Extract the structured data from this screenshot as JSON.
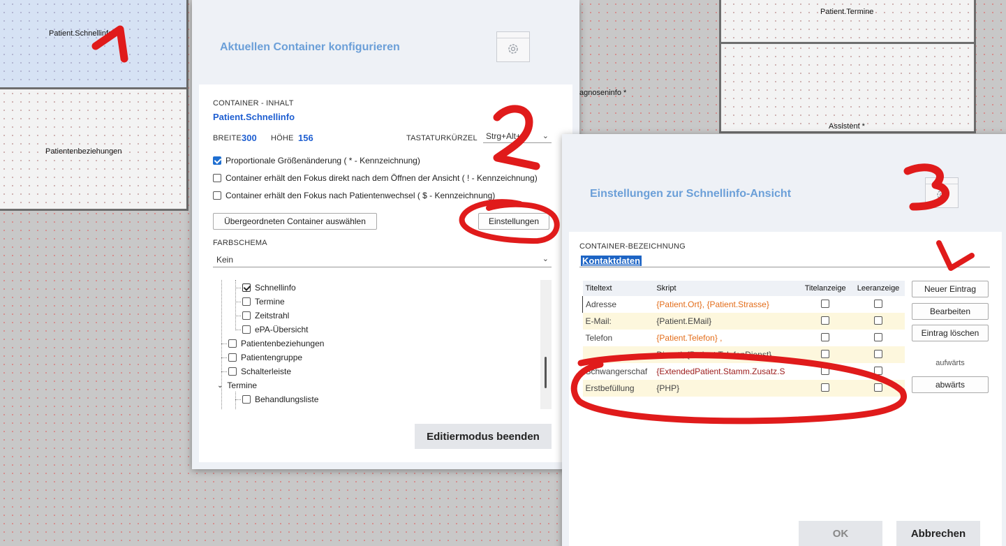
{
  "background": {
    "containers": [
      {
        "label": "Patient.Schnellinfo",
        "selected": true
      },
      {
        "label": "Patientenbeziehungen"
      },
      {
        "label": "Patient.Termine"
      },
      {
        "label": "agnoseninfo *"
      },
      {
        "label": "Assistent *"
      }
    ]
  },
  "dialog1": {
    "title": "Aktuellen Container konfigurieren",
    "section_label": "CONTAINER - INHALT",
    "container_name": "Patient.Schnellinfo",
    "width_label": "BREITE",
    "width_value": "300",
    "height_label": "HÖHE",
    "height_value": "156",
    "shortcut_label": "TASTATURKÜRZEL",
    "shortcut_value": "Strg+Alt+",
    "options": [
      {
        "label": "Proportionale Größenänderung ( * - Kennzeichnung)",
        "checked": true
      },
      {
        "label": "Container erhält den Fokus direkt nach dem Öffnen der Ansicht ( ! - Kennzeichnung)",
        "checked": false
      },
      {
        "label": "Container erhält den Fokus nach Patientenwechsel ( $ - Kennzeichnung)",
        "checked": false
      }
    ],
    "parent_button": "Übergeordneten Container auswählen",
    "settings_button": "Einstellungen",
    "color_label": "FARBSCHEMA",
    "color_value": "Kein",
    "tree": [
      {
        "label": "Schnellinfo",
        "checked": true
      },
      {
        "label": "Termine",
        "checked": false
      },
      {
        "label": "Zeitstrahl",
        "checked": false
      },
      {
        "label": "ePA-Übersicht",
        "checked": false
      },
      {
        "label": "Patientenbeziehungen",
        "checked": false
      },
      {
        "label": "Patientengruppe",
        "checked": false
      },
      {
        "label": "Schalterleiste",
        "checked": false
      },
      {
        "label": "Termine",
        "group": true
      },
      {
        "label": "Behandlungsliste",
        "checked": false
      }
    ],
    "exit_button": "Editiermodus beenden"
  },
  "dialog2": {
    "title": "Einstellungen zur Schnellinfo-Ansicht",
    "name_label": "CONTAINER-BEZEICHNUNG",
    "name_value": "Kontaktdaten",
    "columns": [
      "Titeltext",
      "Skript",
      "Titelanzeige",
      "Leeranzeige"
    ],
    "rows": [
      {
        "title": "Adresse",
        "script": "{Patient.Ort}, {Patient.Strasse}",
        "title_display": false,
        "empty_display": false
      },
      {
        "title": "E-Mail:",
        "script": "{Patient.EMail}",
        "title_display": false,
        "empty_display": false
      },
      {
        "title": "Telefon",
        "script": "{Patient.Telefon} ,",
        "title_display": false,
        "empty_display": false
      },
      {
        "title": "",
        "script": "Dienstl; {Patient.TelefonDienst}",
        "title_display": false,
        "empty_display": false
      },
      {
        "title": "Schwangerschaf",
        "script": "{ExtendedPatient.Stamm.Zusatz.S",
        "title_display": false,
        "empty_display": false
      },
      {
        "title": "Erstbefüllung",
        "script": "{PHP}",
        "title_display": false,
        "empty_display": false
      }
    ],
    "buttons": {
      "new": "Neuer Eintrag",
      "edit": "Bearbeiten",
      "delete": "Eintrag löschen",
      "up": "aufwärts",
      "down": "abwärts"
    },
    "ok": "OK",
    "cancel": "Abbrechen"
  },
  "colors": {
    "accent": "#1f5fd1",
    "title": "#6b9fd8",
    "annotation": "#e01b1b"
  }
}
